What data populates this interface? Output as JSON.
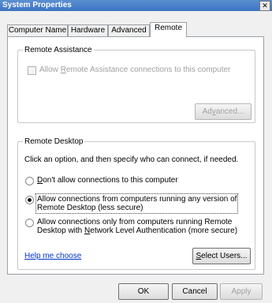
{
  "window": {
    "title": "System Properties",
    "close_glyph": "✕"
  },
  "tabs": [
    {
      "label": "Computer Name",
      "active": false
    },
    {
      "label": "Hardware",
      "active": false
    },
    {
      "label": "Advanced",
      "active": false
    },
    {
      "label": "Remote",
      "active": true
    }
  ],
  "remote_assistance": {
    "group_label": "Remote Assistance",
    "checkbox_pre": "Allow ",
    "checkbox_mnemonic": "R",
    "checkbox_post": "emote Assistance connections to this computer",
    "advanced_pre": "Ad",
    "advanced_mnemonic": "v",
    "advanced_post": "anced..."
  },
  "remote_desktop": {
    "group_label": "Remote Desktop",
    "instruction": "Click an option, and then specify who can connect, if needed.",
    "option1_mnemonic": "D",
    "option1_post": "on't allow connections to this computer",
    "option2_line1": "Allow connections from computers running any version of",
    "option2_line2": "Remote Desktop (less secure)",
    "option3_line1": "Allow connections only from computers running Remote",
    "option3_line2_pre": "Desktop with ",
    "option3_line2_mnemonic": "N",
    "option3_line2_post": "etwork Level Authentication (more secure)",
    "help_link": "Help me choose",
    "select_users_mnemonic": "S",
    "select_users_post": "elect Users..."
  },
  "footer": {
    "ok": "OK",
    "cancel": "Cancel",
    "apply": "Apply"
  }
}
